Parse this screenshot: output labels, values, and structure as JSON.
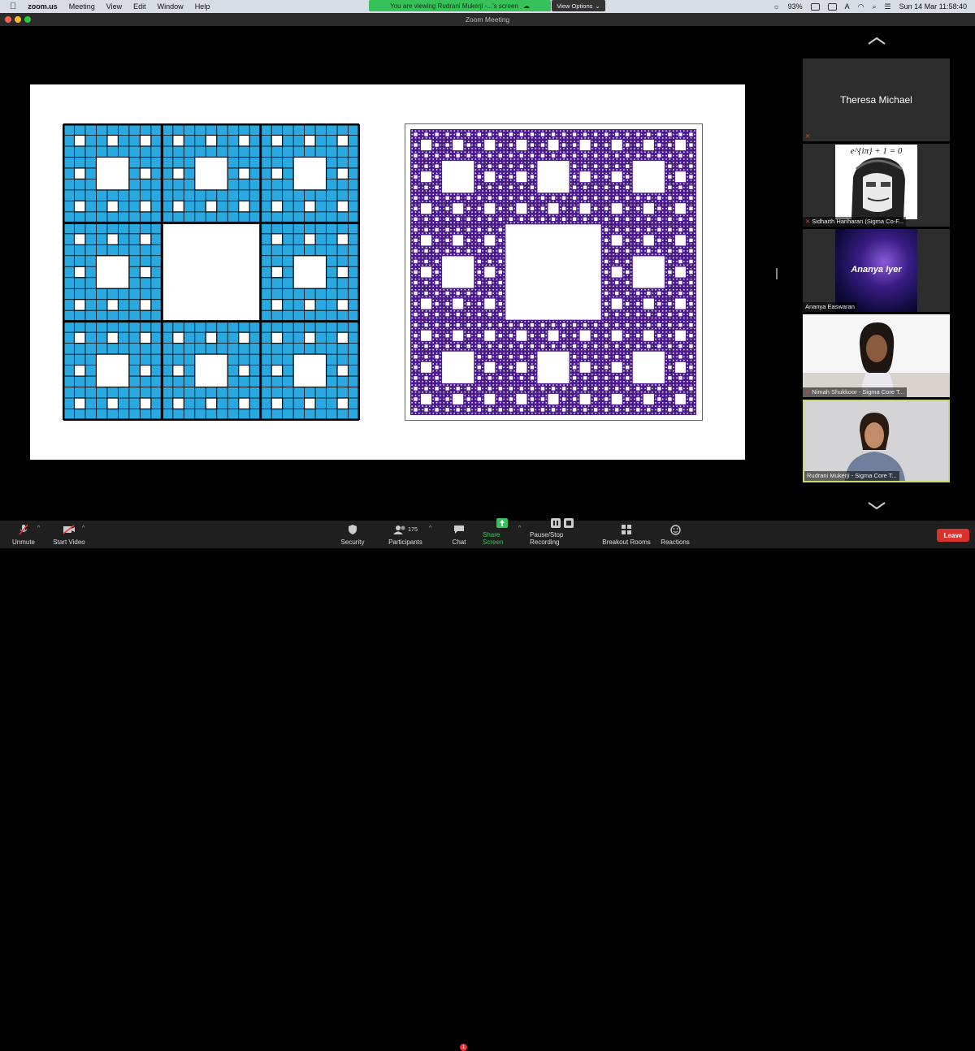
{
  "menubar": {
    "app_name": "zoom.us",
    "menus": [
      "Meeting",
      "View",
      "Edit",
      "Window",
      "Help"
    ],
    "banner": "You are viewing Rudrani Mukerji -...'s screen",
    "view_options": "View Options",
    "battery": "93%",
    "clock": "Sun 14 Mar  11:58:40"
  },
  "window": {
    "title": "Zoom Meeting"
  },
  "shared_screen": {
    "left_fractal": {
      "name": "Sierpinski carpet (level 3, outlined)",
      "fill": "#2aa8e0",
      "stroke": "#000000"
    },
    "right_fractal": {
      "name": "Sierpinski carpet (level 5)",
      "fill": "#4b1a8c"
    }
  },
  "participants": [
    {
      "name": "Theresa Michael",
      "muted": true,
      "type": "name-only"
    },
    {
      "name": "Sidharth Hariharan (Sigma Co-F...",
      "muted": true,
      "type": "avatar",
      "caption": "e^{iπ} + 1 = 0"
    },
    {
      "name": "Ananya Easwaran",
      "muted": false,
      "type": "galaxy",
      "caption": "Ananya Iyer"
    },
    {
      "name": "Nimah Shukkoor - Sigma Core T...",
      "muted": true,
      "type": "video"
    },
    {
      "name": "Rudrani Mukerji - Sigma Core T...",
      "muted": false,
      "type": "video",
      "active_speaker": true
    }
  ],
  "toolbar": {
    "unmute": "Unmute",
    "start_video": "Start Video",
    "security": "Security",
    "participants": "Participants",
    "participants_count": "175",
    "chat": "Chat",
    "chat_badge": "1",
    "share_screen": "Share Screen",
    "record": "Pause/Stop Recording",
    "breakout": "Breakout Rooms",
    "reactions": "Reactions",
    "leave": "Leave"
  },
  "colors": {
    "accent_green": "#37c15a",
    "leave_red": "#d9312c",
    "active_border": "#c8d86a"
  }
}
